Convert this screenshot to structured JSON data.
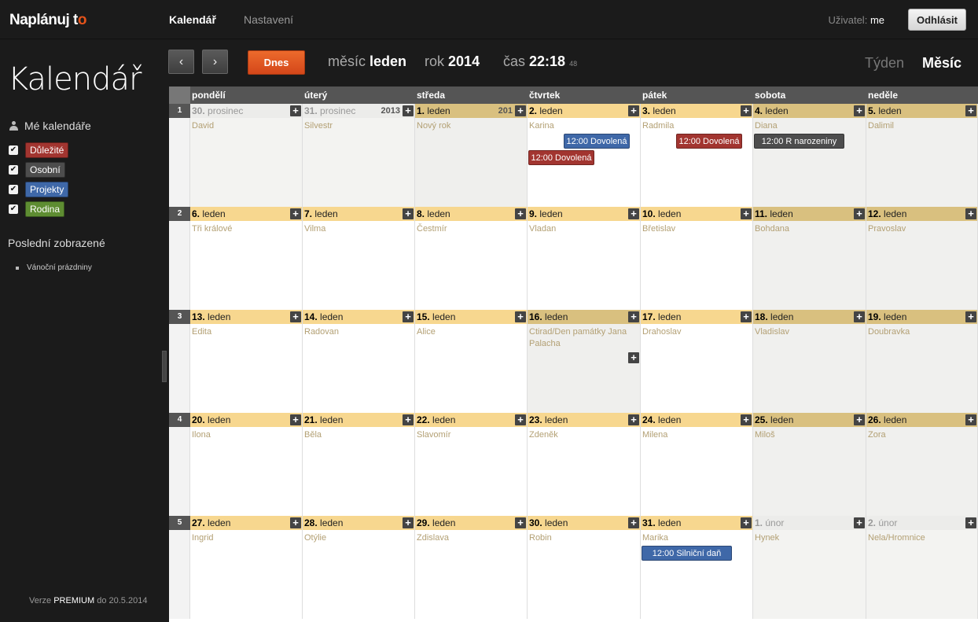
{
  "app": {
    "logo_main": "Naplánuj t",
    "logo_accent": "o"
  },
  "nav": {
    "calendar": "Kalendář",
    "settings": "Nastavení"
  },
  "user": {
    "label": "Uživatel:",
    "name": "me",
    "logout": "Odhlásit"
  },
  "sidebar": {
    "title": "Kalendář",
    "my_calendars": "Mé kalendáře",
    "calendars": [
      {
        "label": "Důležité",
        "color": "#a23530",
        "checked": "✔"
      },
      {
        "label": "Osobní",
        "color": "#4d4d4d",
        "checked": "✔"
      },
      {
        "label": "Projekty",
        "color": "#3f68a8",
        "checked": "✔"
      },
      {
        "label": "Rodina",
        "color": "#5e8d32",
        "checked": "✔"
      }
    ],
    "recent_title": "Poslední zobrazené",
    "recent_items": [
      "Vánoční prázdniny"
    ],
    "version_prefix": "Verze",
    "version_plan": "PREMIUM",
    "version_suffix": "do 20.5.2014"
  },
  "toolbar": {
    "prev": "‹",
    "next": "›",
    "today": "Dnes",
    "month_label": "měsíc",
    "month_value": "leden",
    "year_label": "rok",
    "year_value": "2014",
    "time_label": "čas",
    "time_value": "22:18",
    "time_seconds": "48",
    "view_week": "Týden",
    "view_month": "Měsíc"
  },
  "weekdays": [
    "pondělí",
    "úterý",
    "středa",
    "čtvrtek",
    "pátek",
    "sobota",
    "neděle"
  ],
  "weeks": [
    {
      "num": "1",
      "days": [
        {
          "d": "30.",
          "m": "prosinec",
          "name": "David",
          "year": "",
          "kind": "other"
        },
        {
          "d": "31.",
          "m": "prosinec",
          "name": "Silvestr",
          "year": "2013",
          "kind": "other"
        },
        {
          "d": "1.",
          "m": "leden",
          "name": "Nový rok",
          "year": "201",
          "kind": "today"
        },
        {
          "d": "2.",
          "m": "leden",
          "name": "Karina",
          "year": "",
          "kind": "normal"
        },
        {
          "d": "3.",
          "m": "leden",
          "name": "Radmila",
          "year": "",
          "kind": "normal"
        },
        {
          "d": "4.",
          "m": "leden",
          "name": "Diana",
          "year": "",
          "kind": "weekend"
        },
        {
          "d": "5.",
          "m": "leden",
          "name": "Dalimil",
          "year": "",
          "kind": "weekend"
        }
      ]
    },
    {
      "num": "2",
      "days": [
        {
          "d": "6.",
          "m": "leden",
          "name": "Tři králové",
          "year": "",
          "kind": "normal"
        },
        {
          "d": "7.",
          "m": "leden",
          "name": "Vilma",
          "year": "",
          "kind": "normal"
        },
        {
          "d": "8.",
          "m": "leden",
          "name": "Čestmír",
          "year": "",
          "kind": "normal"
        },
        {
          "d": "9.",
          "m": "leden",
          "name": "Vladan",
          "year": "",
          "kind": "normal"
        },
        {
          "d": "10.",
          "m": "leden",
          "name": "Břetislav",
          "year": "",
          "kind": "normal"
        },
        {
          "d": "11.",
          "m": "leden",
          "name": "Bohdana",
          "year": "",
          "kind": "weekend"
        },
        {
          "d": "12.",
          "m": "leden",
          "name": "Pravoslav",
          "year": "",
          "kind": "weekend"
        }
      ]
    },
    {
      "num": "3",
      "days": [
        {
          "d": "13.",
          "m": "leden",
          "name": "Edita",
          "year": "",
          "kind": "normal"
        },
        {
          "d": "14.",
          "m": "leden",
          "name": "Radovan",
          "year": "",
          "kind": "normal"
        },
        {
          "d": "15.",
          "m": "leden",
          "name": "Alice",
          "year": "",
          "kind": "normal"
        },
        {
          "d": "16.",
          "m": "leden",
          "name": "Ctirad/Den památky Jana Palacha",
          "year": "",
          "kind": "today"
        },
        {
          "d": "17.",
          "m": "leden",
          "name": "Drahoslav",
          "year": "",
          "kind": "normal"
        },
        {
          "d": "18.",
          "m": "leden",
          "name": "Vladislav",
          "year": "",
          "kind": "weekend"
        },
        {
          "d": "19.",
          "m": "leden",
          "name": "Doubravka",
          "year": "",
          "kind": "weekend"
        }
      ]
    },
    {
      "num": "4",
      "days": [
        {
          "d": "20.",
          "m": "leden",
          "name": "Ilona",
          "year": "",
          "kind": "normal"
        },
        {
          "d": "21.",
          "m": "leden",
          "name": "Běla",
          "year": "",
          "kind": "normal"
        },
        {
          "d": "22.",
          "m": "leden",
          "name": "Slavomír",
          "year": "",
          "kind": "normal"
        },
        {
          "d": "23.",
          "m": "leden",
          "name": "Zdeněk",
          "year": "",
          "kind": "normal"
        },
        {
          "d": "24.",
          "m": "leden",
          "name": "Milena",
          "year": "",
          "kind": "normal"
        },
        {
          "d": "25.",
          "m": "leden",
          "name": "Miloš",
          "year": "",
          "kind": "weekend"
        },
        {
          "d": "26.",
          "m": "leden",
          "name": "Zora",
          "year": "",
          "kind": "weekend"
        }
      ]
    },
    {
      "num": "5",
      "days": [
        {
          "d": "27.",
          "m": "leden",
          "name": "Ingrid",
          "year": "",
          "kind": "normal"
        },
        {
          "d": "28.",
          "m": "leden",
          "name": "Otýlie",
          "year": "",
          "kind": "normal"
        },
        {
          "d": "29.",
          "m": "leden",
          "name": "Zdislava",
          "year": "",
          "kind": "normal"
        },
        {
          "d": "30.",
          "m": "leden",
          "name": "Robin",
          "year": "",
          "kind": "normal"
        },
        {
          "d": "31.",
          "m": "leden",
          "name": "Marika",
          "year": "",
          "kind": "normal"
        },
        {
          "d": "1.",
          "m": "únor",
          "name": "Hynek",
          "year": "",
          "kind": "other"
        },
        {
          "d": "2.",
          "m": "únor",
          "name": "Nela/Hromnice",
          "year": "",
          "kind": "other"
        }
      ]
    }
  ],
  "events": [
    {
      "label": "12:00 Dovolená",
      "color": "#3f68a8",
      "week": 0,
      "day": 3,
      "row": 0,
      "align": "right"
    },
    {
      "label": "12:00 Dovolená",
      "color": "#a23530",
      "week": 0,
      "day": 3,
      "row": 1,
      "align": "left"
    },
    {
      "label": "12:00 Dovolená",
      "color": "#a23530",
      "week": 0,
      "day": 4,
      "row": 0,
      "align": "right"
    },
    {
      "label": "12:00 R narozeniny",
      "color": "#4d4d4d",
      "week": 0,
      "day": 5,
      "row": 0,
      "align": "left"
    },
    {
      "label": "12:00 Silniční daň",
      "color": "#3f68a8",
      "week": 4,
      "day": 4,
      "row": 0,
      "align": "left"
    }
  ]
}
